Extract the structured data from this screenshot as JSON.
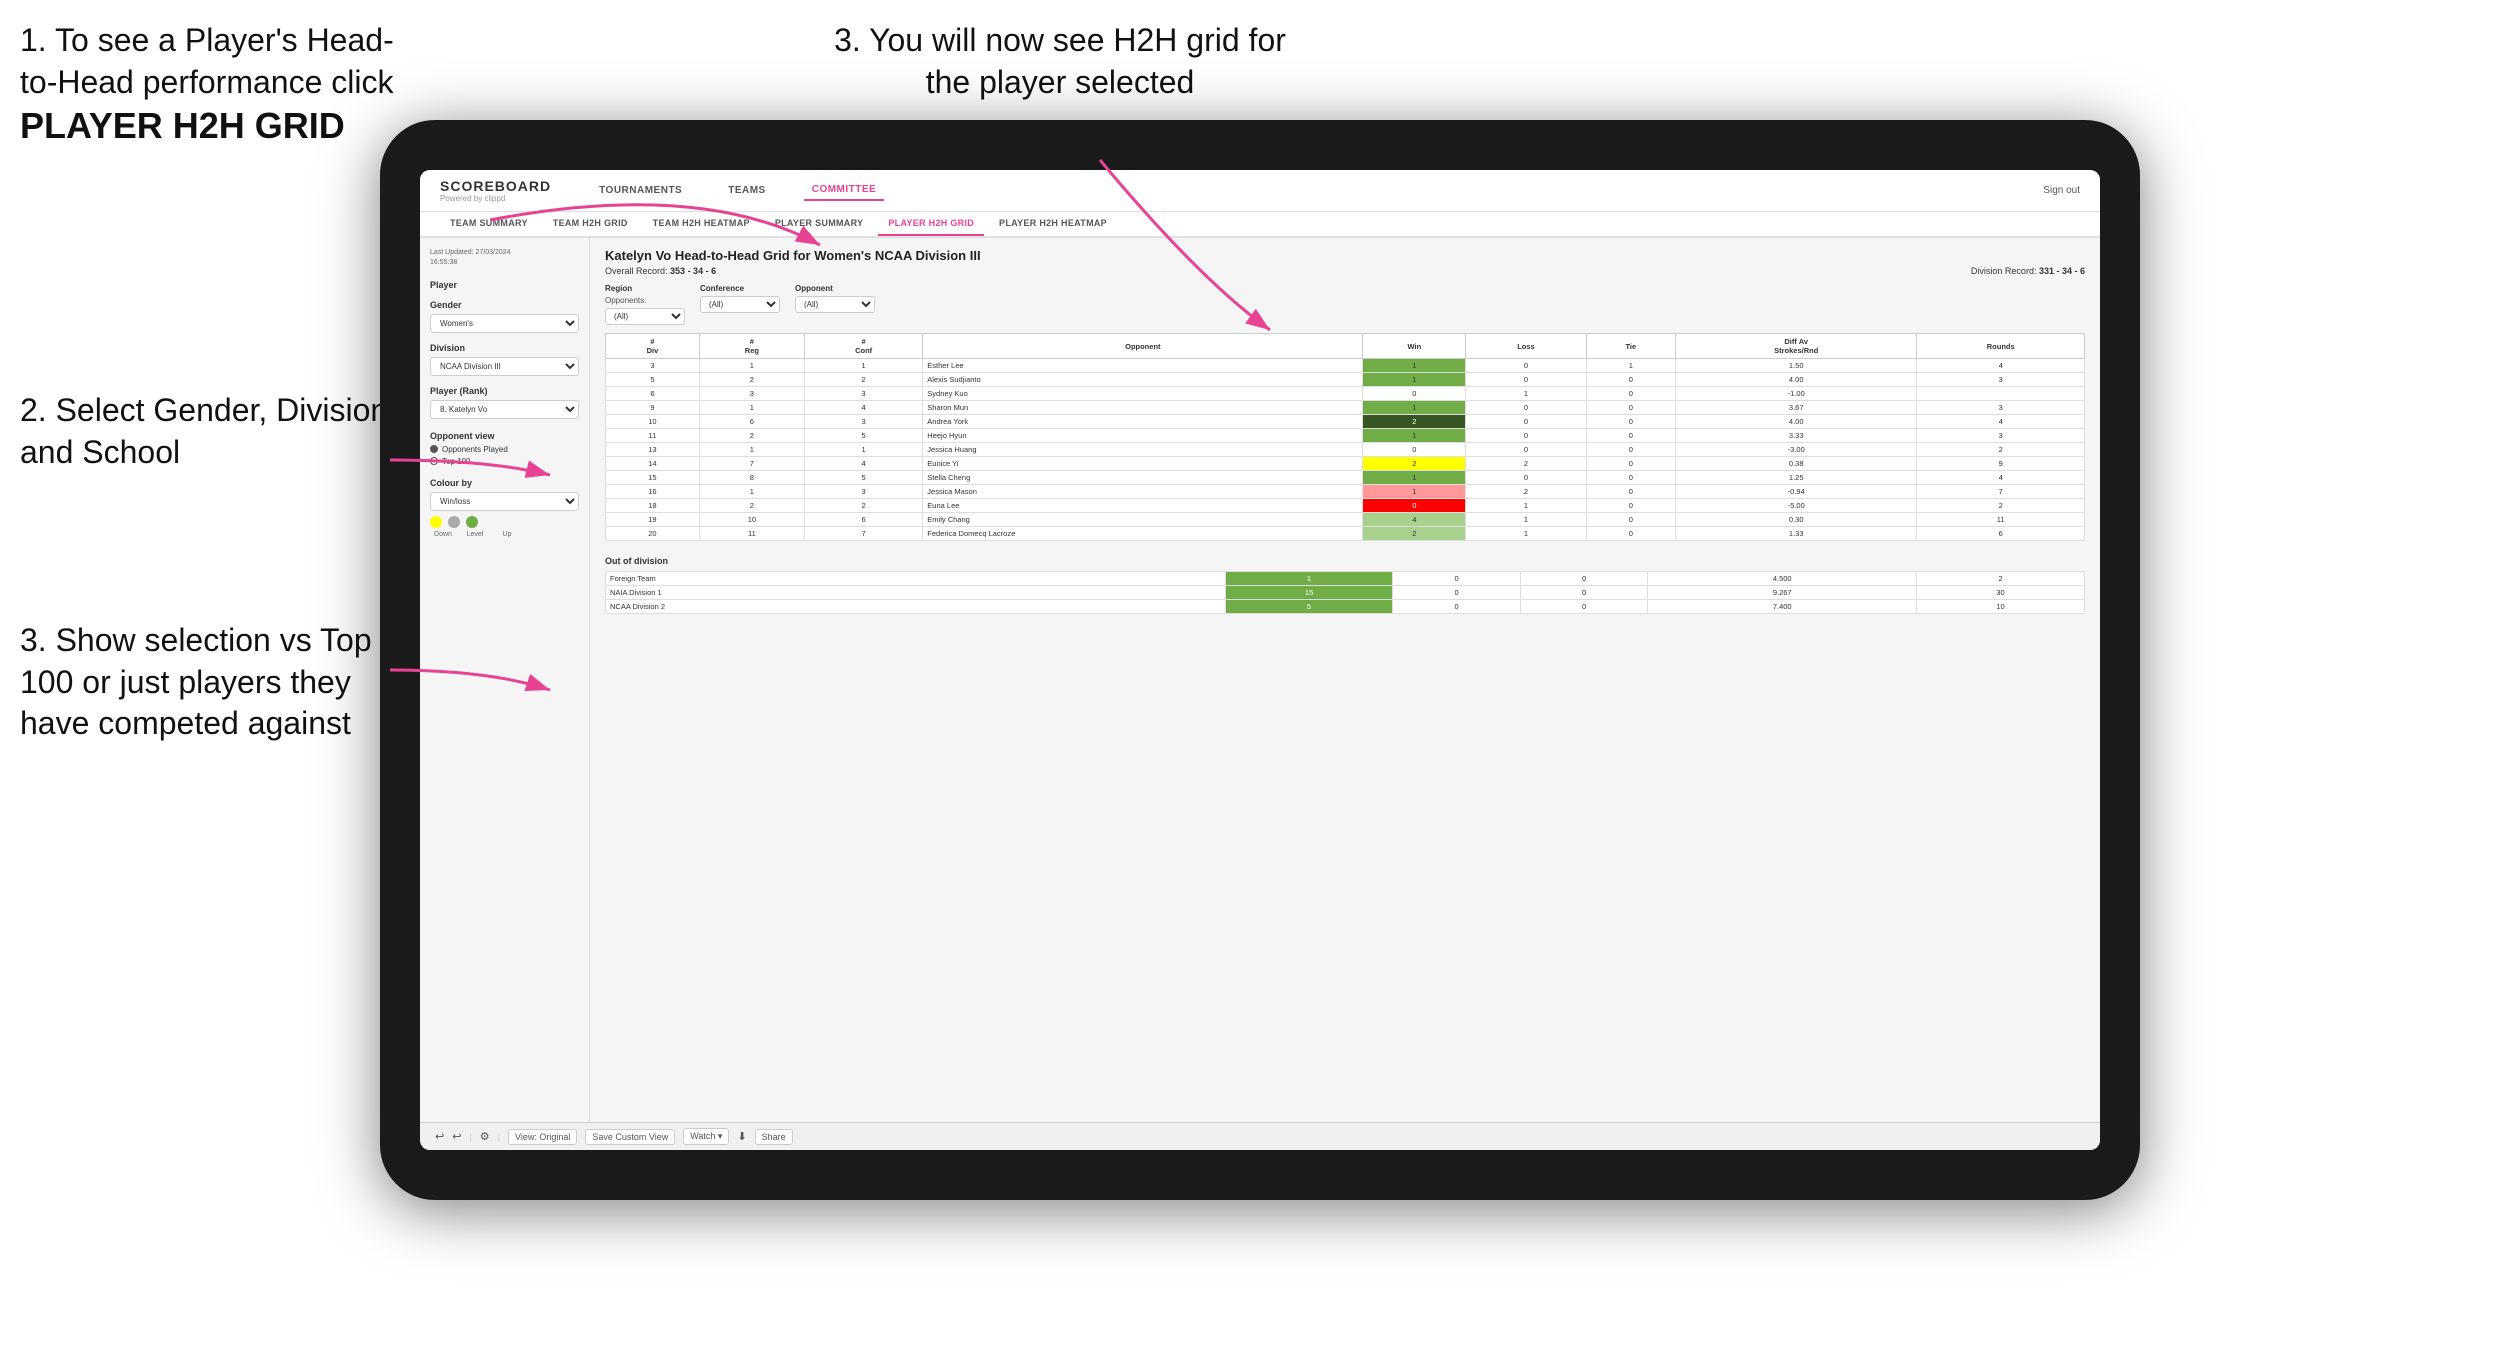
{
  "instructions": {
    "step1": "1. To see a Player's Head-to-Head performance click",
    "step1_bold": "PLAYER H2H GRID",
    "step2": "2. Select Gender, Division and School",
    "step3_left": "3. Show selection vs Top 100 or just players they have competed against",
    "step3_right": "3. You will now see H2H grid for the player selected"
  },
  "nav": {
    "logo": "SCOREBOARD",
    "logo_sub": "Powered by clippd",
    "items": [
      "TOURNAMENTS",
      "TEAMS",
      "COMMITTEE"
    ],
    "active": "COMMITTEE",
    "sign_out": "Sign out"
  },
  "sub_nav": {
    "items": [
      "TEAM SUMMARY",
      "TEAM H2H GRID",
      "TEAM H2H HEATMAP",
      "PLAYER SUMMARY",
      "PLAYER H2H GRID",
      "PLAYER H2H HEATMAP"
    ],
    "active": "PLAYER H2H GRID"
  },
  "left_panel": {
    "last_updated_label": "Last Updated: 27/03/2024",
    "last_updated_time": "16:55:38",
    "player_label": "Player",
    "gender_label": "Gender",
    "gender_value": "Women's",
    "division_label": "Division",
    "division_value": "NCAA Division III",
    "player_rank_label": "Player (Rank)",
    "player_rank_value": "8. Katelyn Vo",
    "opponent_view_label": "Opponent view",
    "opponents_played": "Opponents Played",
    "top_100": "Top 100",
    "colour_by_label": "Colour by",
    "colour_by_value": "Win/loss",
    "colour_labels": [
      "Down",
      "Level",
      "Up"
    ]
  },
  "grid": {
    "title": "Katelyn Vo Head-to-Head Grid for Women's NCAA Division III",
    "overall_record_label": "Overall Record:",
    "overall_record": "353 - 34 - 6",
    "division_record_label": "Division Record:",
    "division_record": "331 - 34 - 6",
    "region_label": "Region",
    "conference_label": "Conference",
    "opponent_label": "Opponent",
    "opponents_label": "Opponents:",
    "all_filter": "(All)",
    "columns": [
      "# Div",
      "# Reg",
      "# Conf",
      "Opponent",
      "Win",
      "Loss",
      "Tie",
      "Diff Av Strokes/Rnd",
      "Rounds"
    ],
    "rows": [
      {
        "div": 3,
        "reg": 1,
        "conf": 1,
        "opponent": "Esther Lee",
        "win": 1,
        "loss": 0,
        "tie": 1,
        "diff": 1.5,
        "rounds": 4,
        "win_color": "green",
        "loss_color": "",
        "tie_color": "yellow"
      },
      {
        "div": 5,
        "reg": 2,
        "conf": 2,
        "opponent": "Alexis Sudjianto",
        "win": 1,
        "loss": 0,
        "tie": 0,
        "diff": 4.0,
        "rounds": 3,
        "win_color": "green"
      },
      {
        "div": 6,
        "reg": 3,
        "conf": 3,
        "opponent": "Sydney Kuo",
        "win": 0,
        "loss": 1,
        "tie": 0,
        "diff": -1.0,
        "rounds": "",
        "win_color": "",
        "loss_color": "light-red"
      },
      {
        "div": 9,
        "reg": 1,
        "conf": 4,
        "opponent": "Sharon Mun",
        "win": 1,
        "loss": 0,
        "tie": 0,
        "diff": 3.67,
        "rounds": 3,
        "win_color": "green"
      },
      {
        "div": 10,
        "reg": 6,
        "conf": 3,
        "opponent": "Andrea York",
        "win": 2,
        "loss": 0,
        "tie": 0,
        "diff": 4.0,
        "rounds": 4,
        "win_color": "dark-green"
      },
      {
        "div": 11,
        "reg": 2,
        "conf": 5,
        "opponent": "Heejo Hyun",
        "win": 1,
        "loss": 0,
        "tie": 0,
        "diff": 3.33,
        "rounds": 3,
        "win_color": "green"
      },
      {
        "div": 13,
        "reg": 1,
        "conf": 1,
        "opponent": "Jessica Huang",
        "win": 0,
        "loss": 0,
        "tie": 0,
        "diff": -3.0,
        "rounds": 2,
        "win_color": ""
      },
      {
        "div": 14,
        "reg": 7,
        "conf": 4,
        "opponent": "Eunice Yi",
        "win": 2,
        "loss": 2,
        "tie": 0,
        "diff": 0.38,
        "rounds": 9,
        "win_color": "yellow"
      },
      {
        "div": 15,
        "reg": 8,
        "conf": 5,
        "opponent": "Stella Cheng",
        "win": 1,
        "loss": 0,
        "tie": 0,
        "diff": 1.25,
        "rounds": 4,
        "win_color": "green"
      },
      {
        "div": 16,
        "reg": 1,
        "conf": 3,
        "opponent": "Jessica Mason",
        "win": 1,
        "loss": 2,
        "tie": 0,
        "diff": -0.94,
        "rounds": 7,
        "win_color": "light-red"
      },
      {
        "div": 18,
        "reg": 2,
        "conf": 2,
        "opponent": "Euna Lee",
        "win": 0,
        "loss": 1,
        "tie": 0,
        "diff": -5.0,
        "rounds": 2,
        "win_color": "red"
      },
      {
        "div": 19,
        "reg": 10,
        "conf": 6,
        "opponent": "Emily Chang",
        "win": 4,
        "loss": 1,
        "tie": 0,
        "diff": 0.3,
        "rounds": 11,
        "win_color": "light-green"
      },
      {
        "div": 20,
        "reg": 11,
        "conf": 7,
        "opponent": "Federica Domecq Lacroze",
        "win": 2,
        "loss": 1,
        "tie": 0,
        "diff": 1.33,
        "rounds": 6,
        "win_color": "light-green"
      }
    ],
    "out_of_division_label": "Out of division",
    "out_rows": [
      {
        "name": "Foreign Team",
        "win": 1,
        "loss": 0,
        "tie": 0,
        "diff": 4.5,
        "rounds": 2
      },
      {
        "name": "NAIA Division 1",
        "win": 15,
        "loss": 0,
        "tie": 0,
        "diff": 9.267,
        "rounds": 30
      },
      {
        "name": "NCAA Division 2",
        "win": 5,
        "loss": 0,
        "tie": 0,
        "diff": 7.4,
        "rounds": 10
      }
    ]
  },
  "toolbar": {
    "view_original": "View: Original",
    "save_custom": "Save Custom View",
    "watch": "Watch ▾",
    "share": "Share"
  },
  "colors": {
    "accent": "#e84393",
    "dark_green": "#375623",
    "green": "#70ad47",
    "light_green": "#a9d18e",
    "yellow": "#ffff00",
    "red": "#ff0000",
    "light_red": "#ff9999",
    "orange": "#ffc000"
  }
}
